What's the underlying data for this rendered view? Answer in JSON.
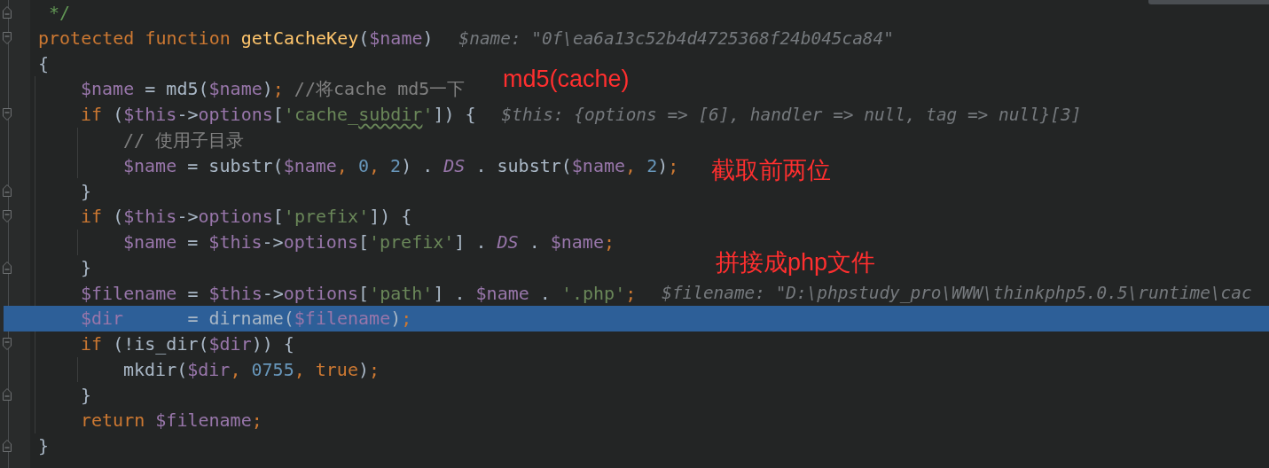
{
  "lines": [
    {
      "selected": false,
      "kind": "closer",
      "tokens": [
        {
          "text": " */",
          "kind": "doc"
        }
      ]
    },
    {
      "selected": false,
      "kind": "opener",
      "hint": "$name: \"0f\\ea6a13c52b4d4725368f24b045ca84\"",
      "tokens": [
        {
          "text": "protected function ",
          "kind": "keyword"
        },
        {
          "text": "getCacheKey",
          "kind": "function"
        },
        {
          "text": "(",
          "kind": "plain"
        },
        {
          "text": "$name",
          "kind": "variable"
        },
        {
          "text": ")",
          "kind": "plain"
        }
      ]
    },
    {
      "selected": false,
      "tokens": [
        {
          "text": "{",
          "kind": "plain"
        }
      ],
      "children": [
        {
          "selected": false,
          "tokens": [
            {
              "text": "$name",
              "kind": "variable"
            },
            {
              "text": " = md5(",
              "kind": "plain"
            },
            {
              "text": "$name",
              "kind": "variable"
            },
            {
              "text": ")",
              "kind": "plain"
            },
            {
              "text": ";",
              "kind": "keyword"
            },
            {
              "text": " //将cache md5一下",
              "kind": "comment"
            }
          ]
        },
        {
          "selected": false,
          "kind": "opener",
          "hint": "$this: {options => [6], handler => null, tag => null}[3]",
          "tokens": [
            {
              "text": "if",
              "kind": "keyword"
            },
            {
              "text": " (",
              "kind": "plain"
            },
            {
              "text": "$this",
              "kind": "variable"
            },
            {
              "text": "->",
              "kind": "plain"
            },
            {
              "text": "options",
              "kind": "variable"
            },
            {
              "text": "[",
              "kind": "plain"
            },
            {
              "text": "'cache_",
              "kind": "string"
            },
            {
              "text": "subdir",
              "kind": "typo"
            },
            {
              "text": "'",
              "kind": "string"
            },
            {
              "text": "]) {",
              "kind": "plain"
            }
          ],
          "children": [
            {
              "selected": false,
              "tokens": [
                {
                  "text": "// 使用子目录",
                  "kind": "comment"
                }
              ]
            },
            {
              "selected": false,
              "tokens": [
                {
                  "text": "$name",
                  "kind": "variable"
                },
                {
                  "text": " = substr(",
                  "kind": "plain"
                },
                {
                  "text": "$name",
                  "kind": "variable"
                },
                {
                  "text": ", ",
                  "kind": "keyword"
                },
                {
                  "text": "0",
                  "kind": "number"
                },
                {
                  "text": ", ",
                  "kind": "keyword"
                },
                {
                  "text": "2",
                  "kind": "number"
                },
                {
                  "text": ") . ",
                  "kind": "plain"
                },
                {
                  "text": "DS",
                  "kind": "constant"
                },
                {
                  "text": " . substr(",
                  "kind": "plain"
                },
                {
                  "text": "$name",
                  "kind": "variable"
                },
                {
                  "text": ", ",
                  "kind": "keyword"
                },
                {
                  "text": "2",
                  "kind": "number"
                },
                {
                  "text": ")",
                  "kind": "plain"
                },
                {
                  "text": ";",
                  "kind": "keyword"
                }
              ]
            }
          ]
        },
        {
          "selected": false,
          "kind": "closer",
          "tokens": [
            {
              "text": "}",
              "kind": "plain"
            }
          ]
        },
        {
          "selected": false,
          "kind": "opener",
          "tokens": [
            {
              "text": "if",
              "kind": "keyword"
            },
            {
              "text": " (",
              "kind": "plain"
            },
            {
              "text": "$this",
              "kind": "variable"
            },
            {
              "text": "->",
              "kind": "plain"
            },
            {
              "text": "options",
              "kind": "variable"
            },
            {
              "text": "[",
              "kind": "plain"
            },
            {
              "text": "'prefix'",
              "kind": "string"
            },
            {
              "text": "]) {",
              "kind": "plain"
            }
          ],
          "children": [
            {
              "selected": false,
              "tokens": [
                {
                  "text": "$name",
                  "kind": "variable"
                },
                {
                  "text": " = ",
                  "kind": "plain"
                },
                {
                  "text": "$this",
                  "kind": "variable"
                },
                {
                  "text": "->",
                  "kind": "plain"
                },
                {
                  "text": "options",
                  "kind": "variable"
                },
                {
                  "text": "[",
                  "kind": "plain"
                },
                {
                  "text": "'prefix'",
                  "kind": "string"
                },
                {
                  "text": "] . ",
                  "kind": "plain"
                },
                {
                  "text": "DS",
                  "kind": "constant"
                },
                {
                  "text": " . ",
                  "kind": "plain"
                },
                {
                  "text": "$name",
                  "kind": "variable"
                },
                {
                  "text": ";",
                  "kind": "keyword"
                }
              ]
            }
          ]
        },
        {
          "selected": false,
          "kind": "closer",
          "tokens": [
            {
              "text": "}",
              "kind": "plain"
            }
          ]
        },
        {
          "selected": false,
          "hint": "$filename: \"D:\\phpstudy_pro\\WWW\\thinkphp5.0.5\\runtime\\cac",
          "tokens": [
            {
              "text": "$filename",
              "kind": "variable"
            },
            {
              "text": " = ",
              "kind": "plain"
            },
            {
              "text": "$this",
              "kind": "variable"
            },
            {
              "text": "->",
              "kind": "plain"
            },
            {
              "text": "options",
              "kind": "variable"
            },
            {
              "text": "[",
              "kind": "plain"
            },
            {
              "text": "'path'",
              "kind": "string"
            },
            {
              "text": "] . ",
              "kind": "plain"
            },
            {
              "text": "$name",
              "kind": "variable"
            },
            {
              "text": " . ",
              "kind": "plain"
            },
            {
              "text": "'.php'",
              "kind": "string"
            },
            {
              "text": ";",
              "kind": "keyword"
            }
          ]
        },
        {
          "selected": true,
          "tokens": [
            {
              "text": "$dir",
              "kind": "variable"
            },
            {
              "text": "      = dirname(",
              "kind": "plain"
            },
            {
              "text": "$filename",
              "kind": "variable"
            },
            {
              "text": ")",
              "kind": "plain"
            },
            {
              "text": ";",
              "kind": "keyword"
            }
          ]
        },
        {
          "selected": false,
          "kind": "opener",
          "tokens": [
            {
              "text": "if",
              "kind": "keyword"
            },
            {
              "text": " (!is_dir(",
              "kind": "plain"
            },
            {
              "text": "$dir",
              "kind": "variable"
            },
            {
              "text": ")) {",
              "kind": "plain"
            }
          ],
          "children": [
            {
              "selected": false,
              "tokens": [
                {
                  "text": "mkdir(",
                  "kind": "plain"
                },
                {
                  "text": "$dir",
                  "kind": "variable"
                },
                {
                  "text": ", ",
                  "kind": "keyword"
                },
                {
                  "text": "0755",
                  "kind": "number"
                },
                {
                  "text": ", true",
                  "kind": "keyword"
                },
                {
                  "text": ")",
                  "kind": "plain"
                },
                {
                  "text": ";",
                  "kind": "keyword"
                }
              ]
            }
          ]
        },
        {
          "selected": false,
          "kind": "closer",
          "tokens": [
            {
              "text": "}",
              "kind": "plain"
            }
          ]
        },
        {
          "selected": false,
          "tokens": [
            {
              "text": "return ",
              "kind": "keyword"
            },
            {
              "text": "$filename",
              "kind": "variable"
            },
            {
              "text": ";",
              "kind": "keyword"
            }
          ]
        }
      ]
    },
    {
      "selected": false,
      "kind": "closer",
      "tokens": [
        {
          "text": "}",
          "kind": "plain"
        }
      ]
    }
  ],
  "annotations": [
    "md5(cache)",
    "截取前两位",
    "拼接成php文件"
  ]
}
